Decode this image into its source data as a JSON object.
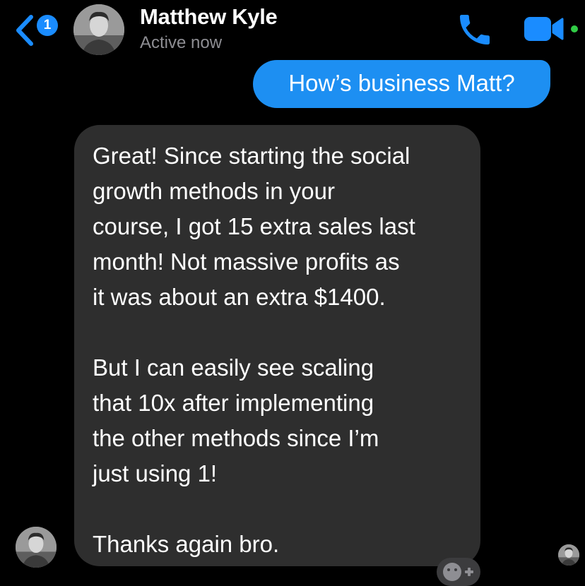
{
  "header": {
    "back_badge_count": "1",
    "contact_name": "Matthew Kyle",
    "status": "Active now",
    "call_icon": "phone-icon",
    "video_icon": "video-camera-icon",
    "online_indicator_color": "#31cc46"
  },
  "messages": {
    "outgoing": {
      "text": "How’s business Matt?",
      "bubble_color": "#1d8ff2"
    },
    "incoming": {
      "bubble_color": "#2e2e2e",
      "lines": [
        "Great! Since starting the social",
        "growth methods in your",
        "course, I got 15 extra sales last",
        "month! Not massive profits as",
        "it was about an extra $1400.",
        "",
        "But I can easily see scaling",
        "that 10x after implementing",
        "the other methods since I’m",
        "just using 1!",
        "",
        "Thanks again bro."
      ]
    }
  },
  "icons": {
    "back": "chevron-left-icon",
    "reaction": "add-reaction-icon",
    "avatar": "avatar"
  },
  "accent_color": "#1a8cff"
}
